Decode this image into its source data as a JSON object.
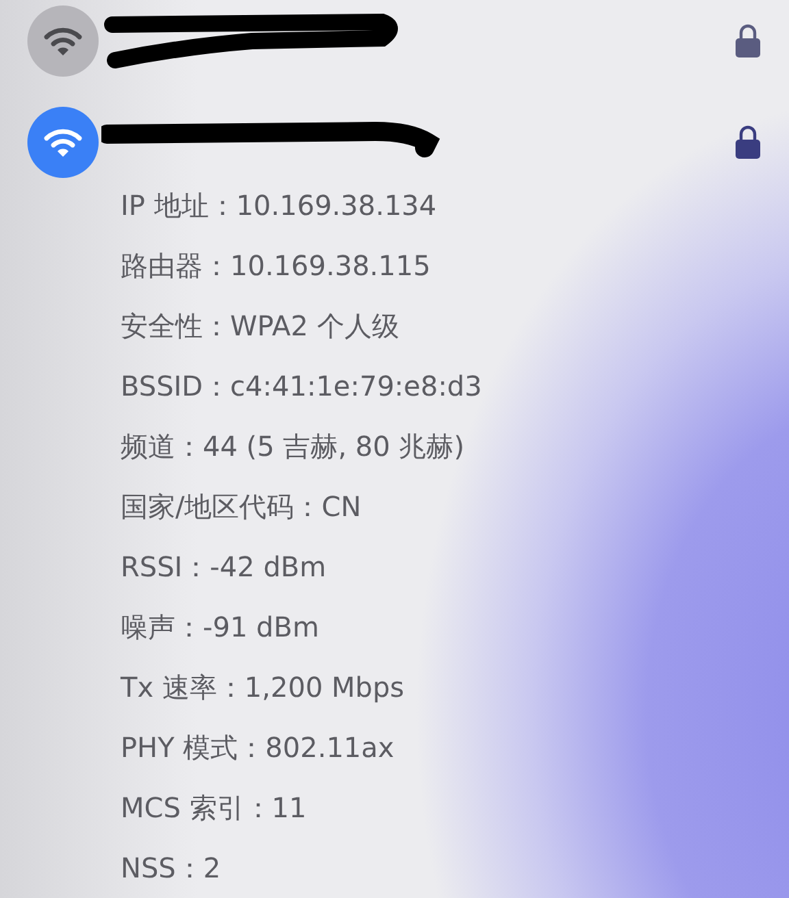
{
  "networks": [
    {
      "connected": false,
      "locked": true
    },
    {
      "connected": true,
      "locked": true
    }
  ],
  "details": [
    "IP 地址：10.169.38.134",
    "路由器：10.169.38.115",
    "安全性：WPA2 个人级",
    "BSSID：c4:41:1e:79:e8:d3",
    "频道：44 (5 吉赫, 80 兆赫)",
    "国家/地区代码：CN",
    "RSSI：-42 dBm",
    "噪声：-91 dBm",
    "Tx 速率：1,200 Mbps",
    "PHY 模式：802.11ax",
    "MCS 索引：11",
    "NSS：2"
  ]
}
